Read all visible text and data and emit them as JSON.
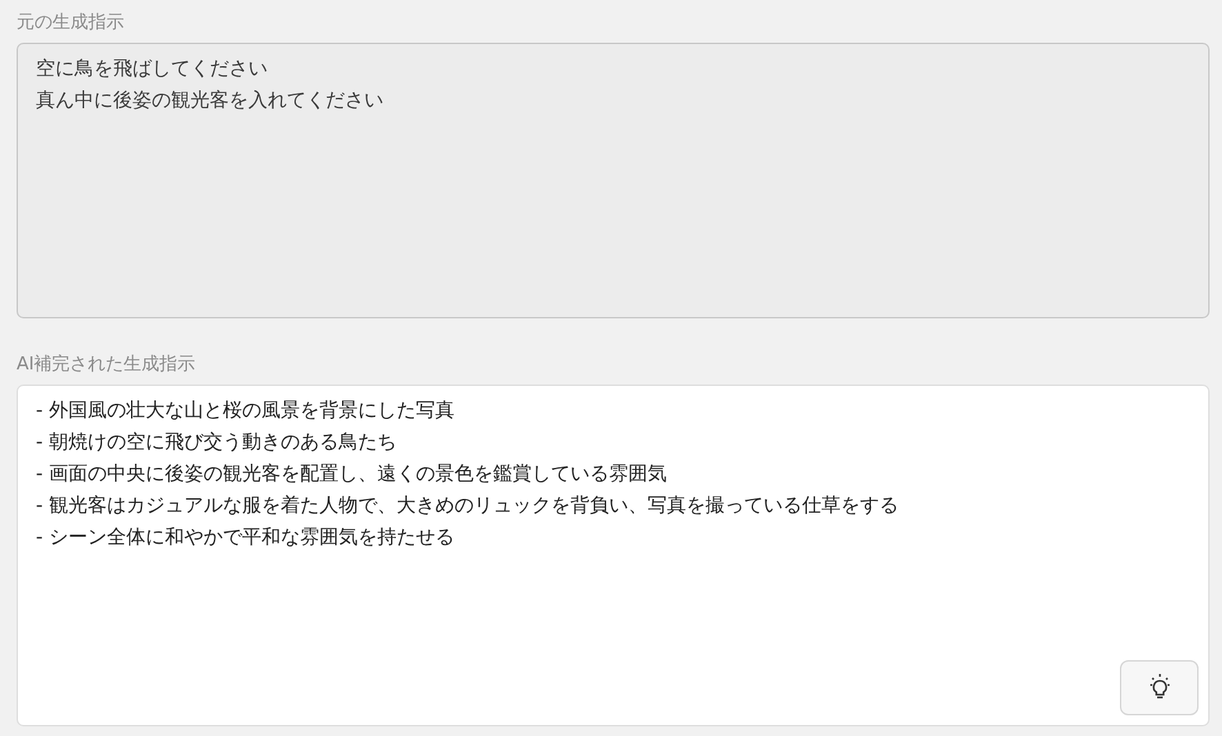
{
  "fields": [
    {
      "label": "元の生成指示",
      "disabled": true,
      "lines": [
        "空に鳥を飛ばしてください",
        "真ん中に後姿の観光客を入れてください"
      ]
    },
    {
      "label": "AI補完された生成指示",
      "disabled": false,
      "lines": [
        "- 外国風の壮大な山と桜の風景を背景にした写真",
        "- 朝焼けの空に飛び交う動きのある鳥たち",
        "- 画面の中央に後姿の観光客を配置し、遠くの景色を鑑賞している雰囲気",
        "- 観光客はカジュアルな服を着た人物で、大きめのリュックを背負い、写真を撮っている仕草をする",
        "- シーン全体に和やかで平和な雰囲気を持たせる"
      ],
      "button": {
        "kind": "lightbulb"
      }
    }
  ]
}
